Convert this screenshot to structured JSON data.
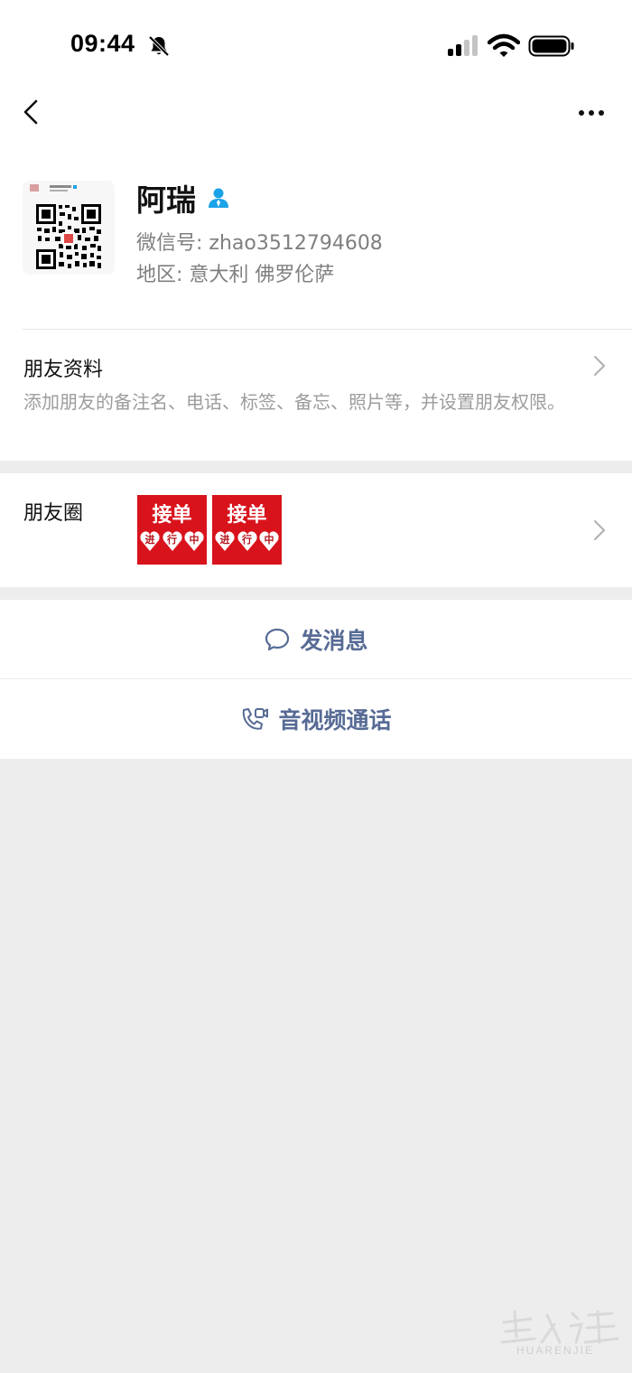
{
  "status_bar": {
    "time": "09:44"
  },
  "profile": {
    "name": "阿瑞",
    "wechat_id": "微信号: zhao3512794608",
    "region": "地区: 意大利 佛罗伦萨"
  },
  "friend_info": {
    "title": "朋友资料",
    "description": "添加朋友的备注名、电话、标签、备忘、照片等，并设置朋友权限。"
  },
  "moments": {
    "label": "朋友圈",
    "thumbs": [
      {
        "title": "接单",
        "hearts": [
          "进",
          "行",
          "中"
        ]
      },
      {
        "title": "接单",
        "hearts": [
          "进",
          "行",
          "中"
        ]
      }
    ]
  },
  "actions": {
    "message": "发消息",
    "call": "音视频通话"
  },
  "watermark": {
    "text": "HUARENJIE"
  },
  "colors": {
    "link_blue": "#576b95",
    "verified_blue": "#1aa3e8",
    "thumb_red": "#d8131c",
    "background": "#ededed"
  }
}
